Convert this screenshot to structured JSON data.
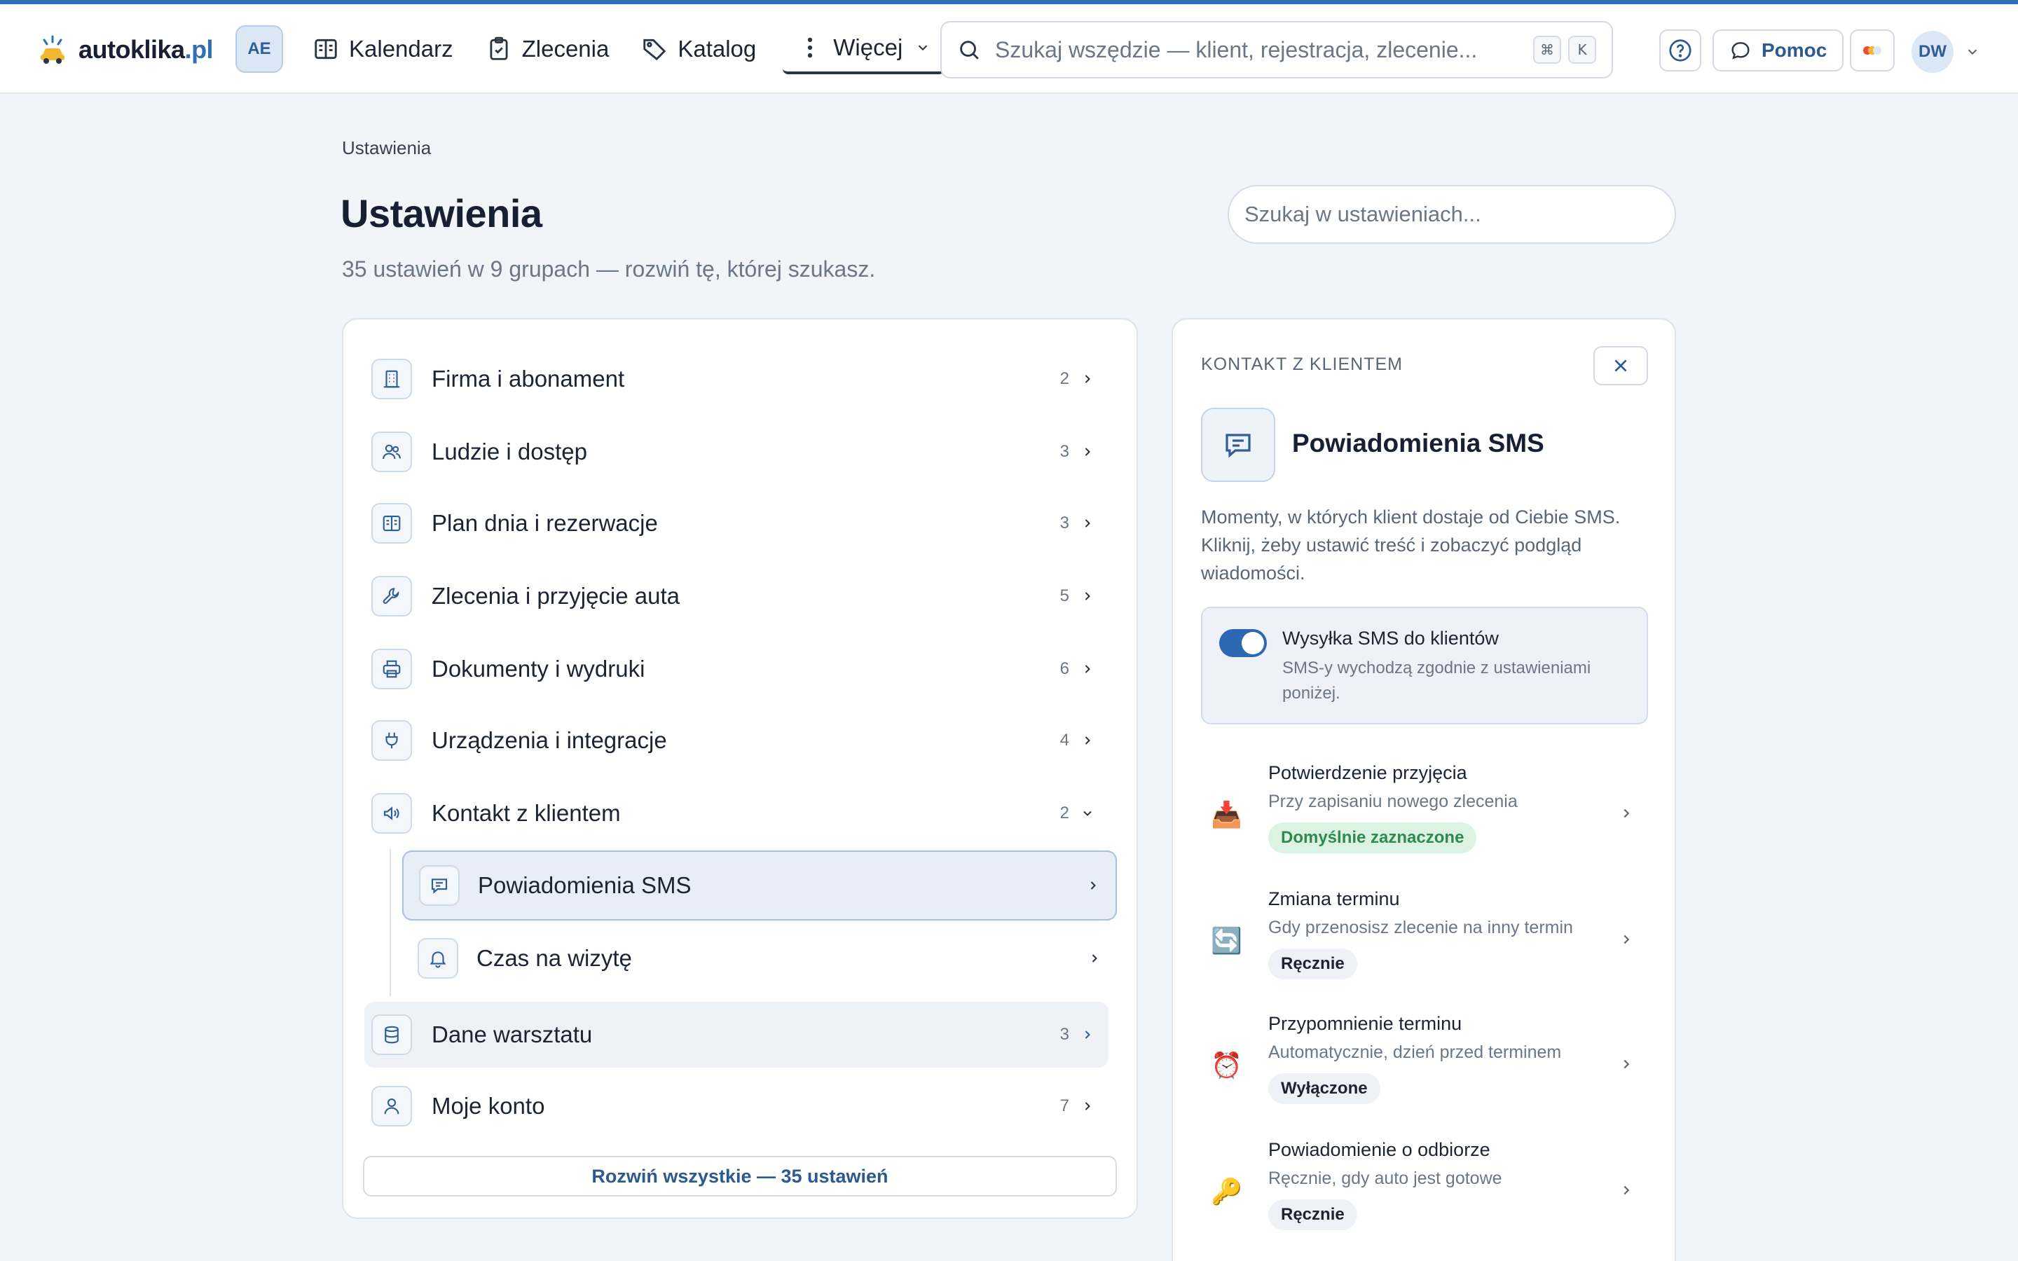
{
  "app": {
    "logo_text": "autoklika",
    "logo_suffix": ".pl",
    "org_initials": "AE"
  },
  "nav": {
    "calendar": "Kalendarz",
    "orders": "Zlecenia",
    "catalog": "Katalog",
    "more": "Więcej"
  },
  "search": {
    "placeholder": "Szukaj wszędzie — klient, rejestracja, zlecenie...",
    "kbd_cmd": "⌘",
    "kbd_key": "K"
  },
  "header_actions": {
    "help_label": "Pomoc",
    "user_initials": "DW"
  },
  "page": {
    "breadcrumb": "Ustawienia",
    "title": "Ustawienia",
    "subtitle": "35 ustawień w 9 grupach — rozwiń tę, której szukasz.",
    "search_placeholder": "Szukaj w ustawieniach..."
  },
  "groups": [
    {
      "label": "Firma i abonament",
      "count": "2",
      "icon": "building-icon"
    },
    {
      "label": "Ludzie i dostęp",
      "count": "3",
      "icon": "users-icon"
    },
    {
      "label": "Plan dnia i rezerwacje",
      "count": "3",
      "icon": "book-open-icon"
    },
    {
      "label": "Zlecenia i przyjęcie auta",
      "count": "5",
      "icon": "wrench-icon"
    },
    {
      "label": "Dokumenty i wydruki",
      "count": "6",
      "icon": "printer-icon"
    },
    {
      "label": "Urządzenia i integracje",
      "count": "4",
      "icon": "plug-icon"
    },
    {
      "label": "Kontakt z klientem",
      "count": "2",
      "icon": "megaphone-icon"
    },
    {
      "label": "Dane warsztatu",
      "count": "3",
      "icon": "database-icon"
    },
    {
      "label": "Moje konto",
      "count": "7",
      "icon": "user-icon"
    }
  ],
  "subgroups": [
    {
      "label": "Powiadomienia SMS",
      "icon": "message-icon",
      "active": true
    },
    {
      "label": "Czas na wizytę",
      "icon": "bell-icon",
      "active": false
    }
  ],
  "expand_all": "Rozwiń wszystkie — 35 ustawień",
  "panel": {
    "eyebrow": "KONTAKT Z KLIENTEM",
    "title": "Powiadomienia SMS",
    "description": "Momenty, w których klient dostaje od Ciebie SMS. Kliknij, żeby ustawić treść i zobaczyć podgląd wiadomości.",
    "toggle_title": "Wysyłka SMS do klientów",
    "toggle_desc": "SMS-y wychodzą zgodnie z ustawieniami poniżej.",
    "toggle_on": true,
    "items": [
      {
        "title": "Potwierdzenie przyjęcia",
        "subtitle": "Przy zapisaniu nowego zlecenia",
        "badge": "Domyślnie zaznaczone",
        "emoji": "📥"
      },
      {
        "title": "Zmiana terminu",
        "subtitle": "Gdy przenosisz zlecenie na inny termin",
        "badge": "Ręcznie",
        "emoji": "🔄"
      },
      {
        "title": "Przypomnienie terminu",
        "subtitle": "Automatycznie, dzień przed terminem",
        "badge": "Wyłączone",
        "emoji": "⏰"
      },
      {
        "title": "Powiadomienie o odbiorze",
        "subtitle": "Ręcznie, gdy auto jest gotowe",
        "badge": "Ręcznie",
        "emoji": "🔑"
      }
    ]
  },
  "colors": {
    "accent": "#2f6fb8",
    "background": "#f1f4f8",
    "badge_green": "#2f8a50"
  }
}
